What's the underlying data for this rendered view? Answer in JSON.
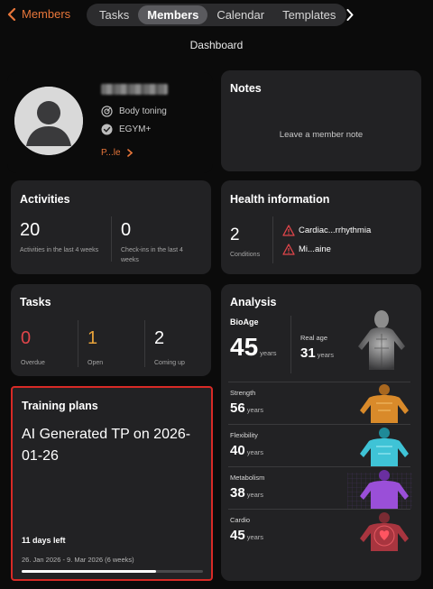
{
  "nav": {
    "back_label": "Members",
    "tabs": [
      "Tasks",
      "Members",
      "Calendar",
      "Templates"
    ],
    "active_tab": "Members"
  },
  "page_title": "Dashboard",
  "profile": {
    "goal": "Body toning",
    "membership": "EGYM+",
    "profile_link": "P...le"
  },
  "notes": {
    "title": "Notes",
    "placeholder": "Leave a member note"
  },
  "activities": {
    "title": "Activities",
    "stats": [
      {
        "value": "20",
        "label": "Activities in the last 4 weeks"
      },
      {
        "value": "0",
        "label": "Check-ins in the last 4 weeks"
      }
    ]
  },
  "health": {
    "title": "Health information",
    "count": "2",
    "count_label": "Conditions",
    "conditions": [
      "Cardiac...rrhythmia",
      "Mi...aine"
    ]
  },
  "tasks": {
    "title": "Tasks",
    "stats": [
      {
        "value": "0",
        "label": "Overdue",
        "color": "#e0454a"
      },
      {
        "value": "1",
        "label": "Open",
        "color": "#e8a33a"
      },
      {
        "value": "2",
        "label": "Coming up",
        "color": "#ffffff"
      }
    ]
  },
  "training": {
    "title": "Training plans",
    "plan_name": "AI Generated TP on 2026-01-26",
    "days_left": "11 days left",
    "date_range": "26. Jan 2026 - 9. Mar 2026 (6 weeks)",
    "progress": 0.74
  },
  "analysis": {
    "title": "Analysis",
    "bioage_label": "BioAge",
    "bioage_value": "45",
    "real_age_label": "Real age",
    "real_age_value": "31",
    "unit": "years",
    "metrics": [
      {
        "label": "Strength",
        "value": "56",
        "unit": "years",
        "color": "#e8a33a"
      },
      {
        "label": "Flexibility",
        "value": "40",
        "unit": "years",
        "color": "#3fc3d6"
      },
      {
        "label": "Metabolism",
        "value": "38",
        "unit": "years",
        "color": "#9a4fd8"
      },
      {
        "label": "Cardio",
        "value": "45",
        "unit": "years",
        "color": "#d8404a"
      }
    ]
  }
}
